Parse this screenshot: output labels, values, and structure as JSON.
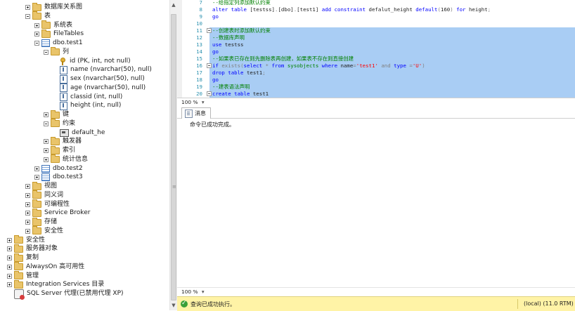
{
  "explorer": {
    "rows": [
      {
        "level": 3,
        "toggle": "plus",
        "icon": "folder",
        "label": "数据库关系图"
      },
      {
        "level": 3,
        "toggle": "minus",
        "icon": "folder",
        "label": "表"
      },
      {
        "level": 4,
        "toggle": "plus",
        "icon": "folder",
        "label": "系统表"
      },
      {
        "level": 4,
        "toggle": "plus",
        "icon": "folder",
        "label": "FileTables"
      },
      {
        "level": 4,
        "toggle": "minus",
        "icon": "table",
        "label": "dbo.test1"
      },
      {
        "level": 5,
        "toggle": "minus",
        "icon": "folder",
        "label": "列"
      },
      {
        "level": 6,
        "toggle": "none",
        "icon": "key",
        "label": "id (PK, int, not null)"
      },
      {
        "level": 6,
        "toggle": "none",
        "icon": "column",
        "label": "name (nvarchar(50), null)"
      },
      {
        "level": 6,
        "toggle": "none",
        "icon": "column",
        "label": "sex (nvarchar(50), null)"
      },
      {
        "level": 6,
        "toggle": "none",
        "icon": "column",
        "label": "age (nvarchar(50), null)"
      },
      {
        "level": 6,
        "toggle": "none",
        "icon": "column",
        "label": "classid (int, null)"
      },
      {
        "level": 6,
        "toggle": "none",
        "icon": "column",
        "label": "height (int, null)"
      },
      {
        "level": 5,
        "toggle": "plus",
        "icon": "folder",
        "label": "键"
      },
      {
        "level": 5,
        "toggle": "minus",
        "icon": "folder",
        "label": "约束"
      },
      {
        "level": 6,
        "toggle": "none",
        "icon": "constraint",
        "label": "default_he"
      },
      {
        "level": 5,
        "toggle": "plus",
        "icon": "folder",
        "label": "触发器"
      },
      {
        "level": 5,
        "toggle": "plus",
        "icon": "folder",
        "label": "索引"
      },
      {
        "level": 5,
        "toggle": "plus",
        "icon": "folder",
        "label": "统计信息"
      },
      {
        "level": 4,
        "toggle": "plus",
        "icon": "table",
        "label": "dbo.test2"
      },
      {
        "level": 4,
        "toggle": "plus",
        "icon": "table",
        "label": "dbo.test3"
      },
      {
        "level": 3,
        "toggle": "plus",
        "icon": "folder",
        "label": "视图"
      },
      {
        "level": 3,
        "toggle": "plus",
        "icon": "folder",
        "label": "同义词"
      },
      {
        "level": 3,
        "toggle": "plus",
        "icon": "folder",
        "label": "可编程性"
      },
      {
        "level": 3,
        "toggle": "plus",
        "icon": "folder",
        "label": "Service Broker"
      },
      {
        "level": 3,
        "toggle": "plus",
        "icon": "folder",
        "label": "存储"
      },
      {
        "level": 3,
        "toggle": "plus",
        "icon": "folder",
        "label": "安全性"
      },
      {
        "level": 1,
        "toggle": "plus",
        "icon": "folder",
        "label": "安全性"
      },
      {
        "level": 1,
        "toggle": "plus",
        "icon": "folder",
        "label": "服务器对象"
      },
      {
        "level": 1,
        "toggle": "plus",
        "icon": "folder",
        "label": "复制"
      },
      {
        "level": 1,
        "toggle": "plus",
        "icon": "folder",
        "label": "AlwaysOn 高可用性"
      },
      {
        "level": 1,
        "toggle": "plus",
        "icon": "folder",
        "label": "管理"
      },
      {
        "level": 1,
        "toggle": "plus",
        "icon": "folder",
        "label": "Integration Services 目录"
      },
      {
        "level": 1,
        "toggle": "none",
        "icon": "agent",
        "label": "SQL Server 代理(已禁用代理 XP)"
      }
    ]
  },
  "editor": {
    "lines": [
      {
        "num": "7",
        "tokens": [
          {
            "t": "--给指定列添加默认约束",
            "c": "cmt"
          }
        ]
      },
      {
        "num": "8",
        "tokens": [
          {
            "t": "alter table ",
            "c": "kw"
          },
          {
            "t": "[testss]",
            "c": "plain"
          },
          {
            "t": ".",
            "c": "gray"
          },
          {
            "t": "[dbo]",
            "c": "plain"
          },
          {
            "t": ".",
            "c": "gray"
          },
          {
            "t": "[test1] ",
            "c": "plain"
          },
          {
            "t": "add constraint ",
            "c": "kw"
          },
          {
            "t": "defalut_height ",
            "c": "plain"
          },
          {
            "t": "default",
            "c": "kw"
          },
          {
            "t": "(",
            "c": "gray"
          },
          {
            "t": "160",
            "c": "plain"
          },
          {
            "t": ") ",
            "c": "gray"
          },
          {
            "t": "for ",
            "c": "kw"
          },
          {
            "t": "height",
            "c": "plain"
          },
          {
            "t": ";",
            "c": "gray"
          }
        ]
      },
      {
        "num": "9",
        "tokens": [
          {
            "t": "go",
            "c": "kw"
          }
        ]
      },
      {
        "num": "10",
        "tokens": []
      },
      {
        "num": "11",
        "fold": true,
        "tokens": [
          {
            "t": "--创建表时添加默认约束",
            "c": "cmt"
          }
        ]
      },
      {
        "num": "12",
        "tokens": [
          {
            "t": "--数据库声明",
            "c": "cmt"
          }
        ]
      },
      {
        "num": "13",
        "tokens": [
          {
            "t": "use ",
            "c": "kw"
          },
          {
            "t": "testss",
            "c": "plain"
          }
        ]
      },
      {
        "num": "14",
        "tokens": [
          {
            "t": "go",
            "c": "kw"
          }
        ]
      },
      {
        "num": "15",
        "tokens": [
          {
            "t": "--如果表已存在则先删除表再创建，如果表不存在则直接创建",
            "c": "cmt"
          }
        ]
      },
      {
        "num": "16",
        "fold": true,
        "tokens": [
          {
            "t": "if ",
            "c": "kw"
          },
          {
            "t": "exists",
            "c": "gray"
          },
          {
            "t": "(",
            "c": "gray"
          },
          {
            "t": "select ",
            "c": "kw"
          },
          {
            "t": "* ",
            "c": "gray"
          },
          {
            "t": "from ",
            "c": "kw"
          },
          {
            "t": "sysobjects ",
            "c": "sysobj"
          },
          {
            "t": "where ",
            "c": "kw"
          },
          {
            "t": "name",
            "c": "plain"
          },
          {
            "t": "=",
            "c": "gray"
          },
          {
            "t": "'test1'",
            "c": "str"
          },
          {
            "t": " and ",
            "c": "gray"
          },
          {
            "t": "type ",
            "c": "kw"
          },
          {
            "t": "=",
            "c": "gray"
          },
          {
            "t": "'U'",
            "c": "str"
          },
          {
            "t": ")",
            "c": "gray"
          }
        ]
      },
      {
        "num": "17",
        "tokens": [
          {
            "t": "drop table ",
            "c": "kw"
          },
          {
            "t": "test1",
            "c": "plain"
          },
          {
            "t": ";",
            "c": "gray"
          }
        ]
      },
      {
        "num": "18",
        "tokens": [
          {
            "t": "go",
            "c": "kw"
          }
        ]
      },
      {
        "num": "19",
        "tokens": [
          {
            "t": "--建表语法声明",
            "c": "cmt"
          }
        ]
      },
      {
        "num": "20",
        "fold": true,
        "tokens": [
          {
            "t": "create table ",
            "c": "kw"
          },
          {
            "t": "test1",
            "c": "plain"
          }
        ]
      }
    ],
    "zoom_top": "100 %",
    "zoom_bottom": "100 %",
    "messages_tab_label": "消息",
    "message_text": "命令已成功完成。",
    "status_text": "查询已成功执行。",
    "status_server": "(local) (11.0 RTM)"
  },
  "colors": {
    "selection": "#a9cdf4",
    "status_bar": "#fff3a6",
    "keyword": "#0000ff",
    "comment": "#008000",
    "string": "#ff0000"
  }
}
